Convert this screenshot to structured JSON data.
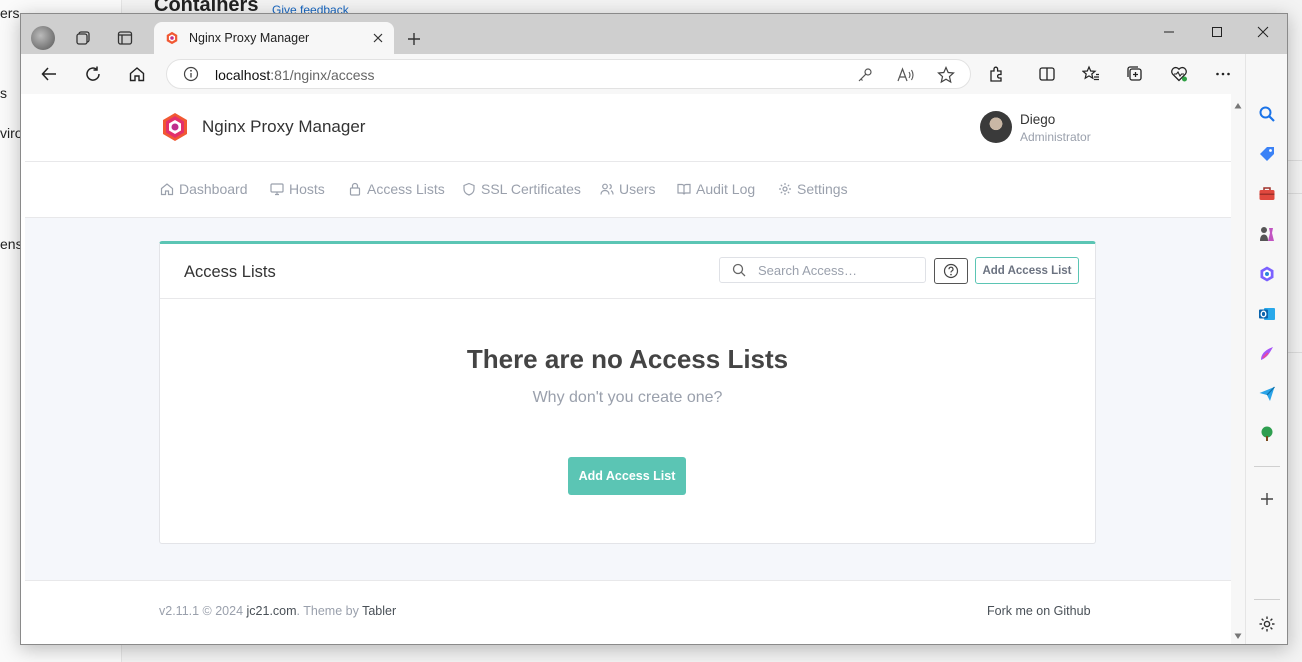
{
  "background_app": {
    "title": "Containers",
    "feedback_link": "Give feedback",
    "fragments": [
      "ers",
      "s",
      "viro",
      "ens"
    ]
  },
  "browser": {
    "tab_title": "Nginx Proxy Manager",
    "url_host": "localhost",
    "url_rest": ":81/nginx/access"
  },
  "app": {
    "brand": "Nginx Proxy Manager",
    "user": {
      "name": "Diego",
      "role": "Administrator"
    },
    "nav": [
      {
        "label": "Dashboard",
        "icon": "home-icon"
      },
      {
        "label": "Hosts",
        "icon": "monitor-icon"
      },
      {
        "label": "Access Lists",
        "icon": "lock-icon"
      },
      {
        "label": "SSL Certificates",
        "icon": "shield-icon"
      },
      {
        "label": "Users",
        "icon": "users-icon"
      },
      {
        "label": "Audit Log",
        "icon": "book-icon"
      },
      {
        "label": "Settings",
        "icon": "gear-icon"
      }
    ],
    "card": {
      "title": "Access Lists",
      "search_placeholder": "Search Access…",
      "add_button": "Add Access List",
      "empty_title": "There are no Access Lists",
      "empty_subtitle": "Why don't you create one?",
      "empty_button": "Add Access List"
    },
    "footer": {
      "version": "v2.11.1 © 2024 ",
      "company": "jc21.com",
      "theme_prefix": ". Theme by ",
      "theme": "Tabler",
      "fork": "Fork me on Github"
    }
  },
  "colors": {
    "accent": "#5bc5b4",
    "muted": "#9aa0ac",
    "text": "#333333"
  }
}
